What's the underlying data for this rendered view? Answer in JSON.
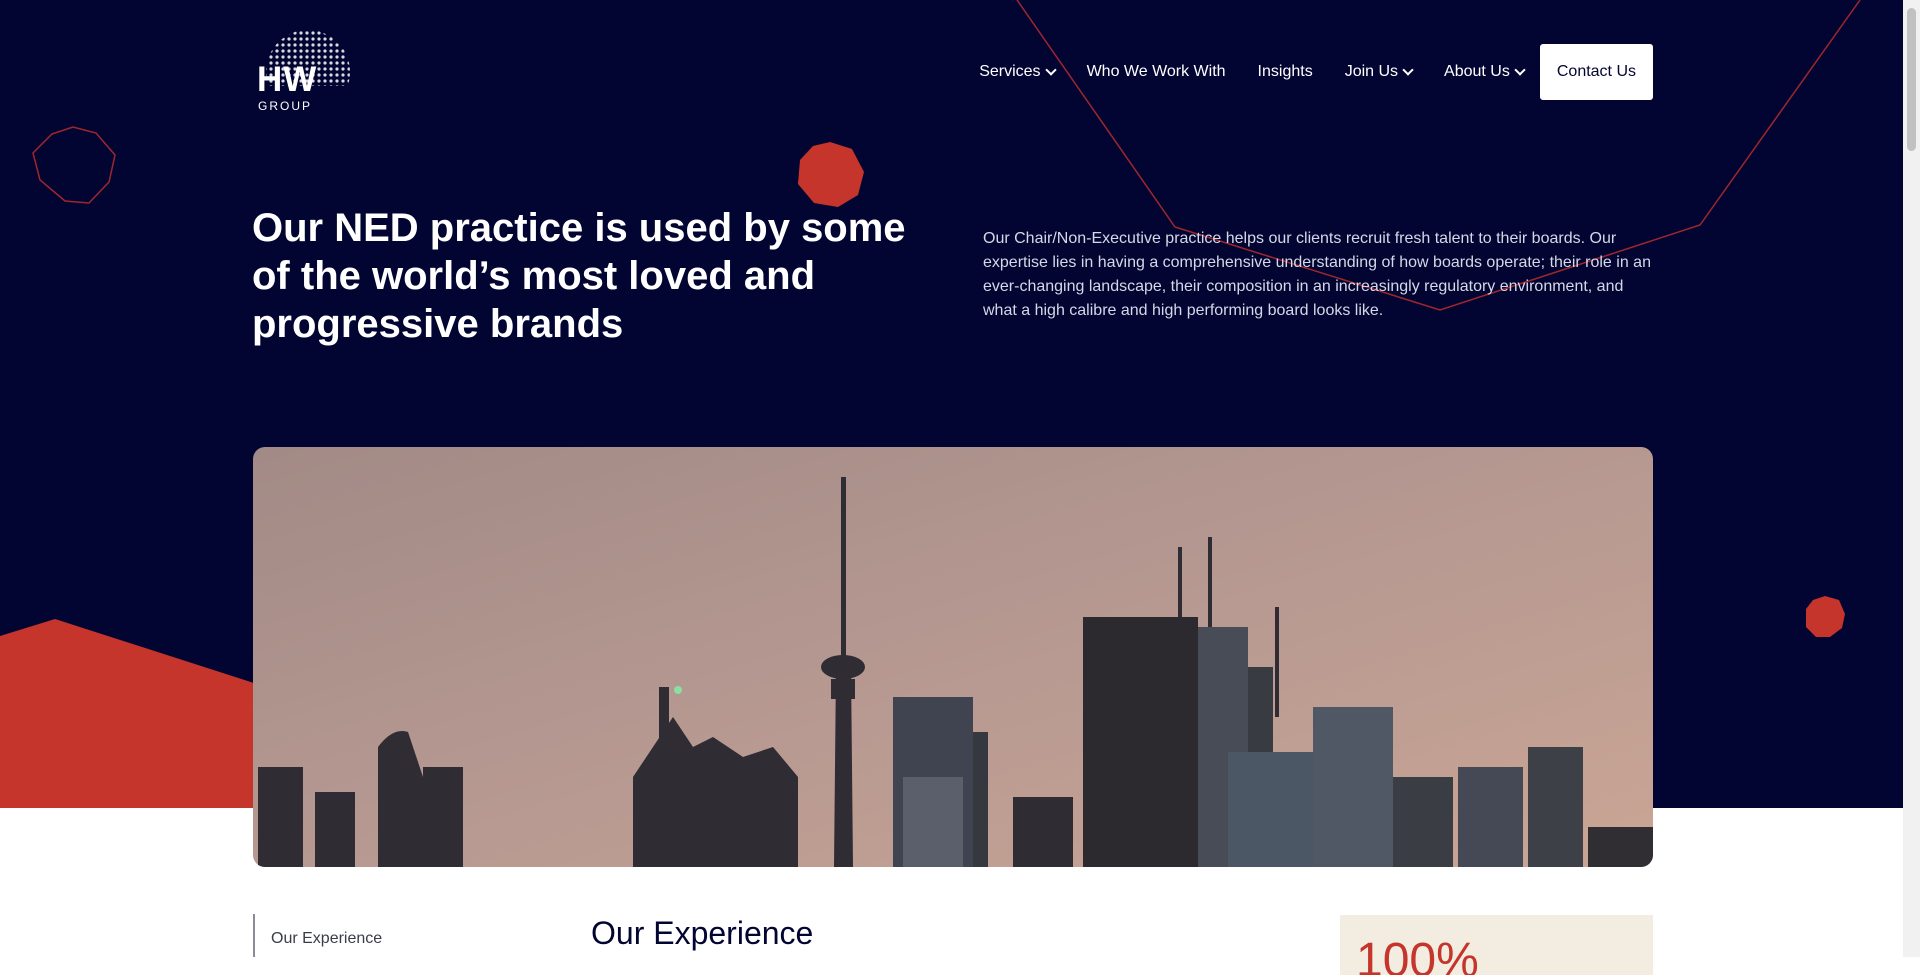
{
  "brand": {
    "logo_text": "HW",
    "logo_subtext": "GROUP"
  },
  "nav": {
    "items": [
      {
        "label": "Services",
        "has_dropdown": true
      },
      {
        "label": "Who We Work With",
        "has_dropdown": false
      },
      {
        "label": "Insights",
        "has_dropdown": false
      },
      {
        "label": "Join Us",
        "has_dropdown": true
      },
      {
        "label": "About Us",
        "has_dropdown": true
      }
    ],
    "contact_label": "Contact Us"
  },
  "hero": {
    "headline": "Our NED practice is used by some of the world’s most loved and progressive brands",
    "intro": "Our Chair/Non-Executive practice helps our clients recruit fresh talent to their boards. Our expertise lies in having a comprehensive understanding of how boards operate; their role in an ever-changing landscape, their composition in an increasingly regulatory environment, and what a high calibre and high performing board looks like."
  },
  "side_nav": {
    "items": [
      "Our Experience"
    ]
  },
  "main": {
    "section_title": "Our Experience"
  },
  "stat": {
    "value": "100%"
  },
  "colors": {
    "navy": "#020532",
    "accent_red": "#c5352b",
    "cream": "#f2ede0",
    "white": "#ffffff"
  }
}
